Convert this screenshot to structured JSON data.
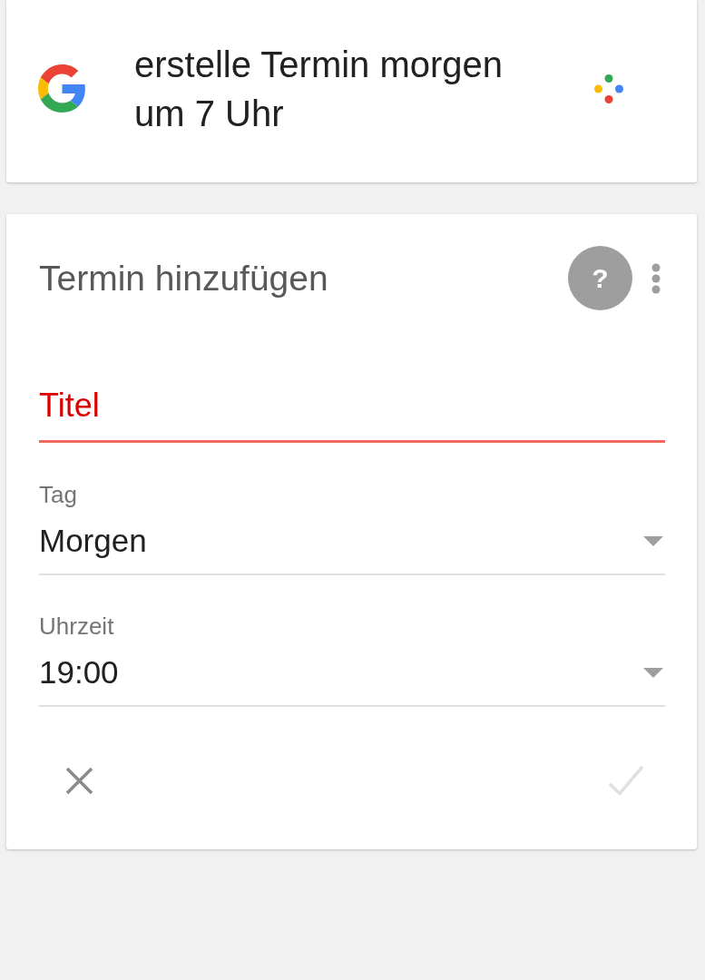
{
  "query_card": {
    "text": "erstelle Termin morgen um 7 Uhr"
  },
  "event_card": {
    "title": "Termin hinzufügen",
    "help_button": {
      "label": "?"
    },
    "title_field": {
      "placeholder": "Titel",
      "error": true
    },
    "fields": [
      {
        "label": "Tag",
        "value": "Morgen"
      },
      {
        "label": "Uhrzeit",
        "value": "19:00"
      }
    ],
    "actions": [
      {
        "kind": "cancel",
        "disabled": false
      },
      {
        "kind": "confirm",
        "disabled": true
      }
    ]
  }
}
